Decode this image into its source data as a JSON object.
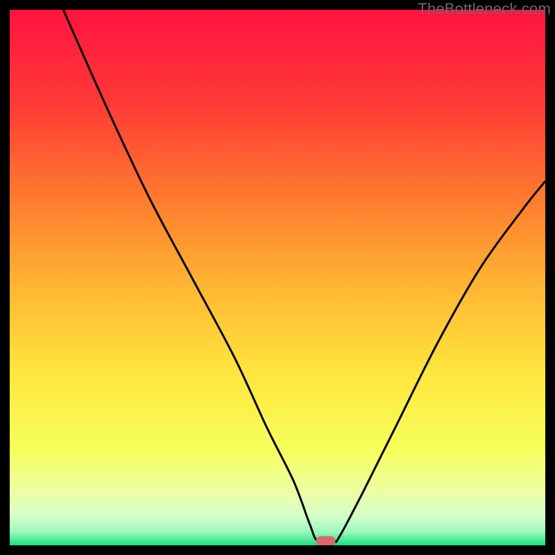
{
  "watermark": "TheBottleneck.com",
  "chart_data": {
    "type": "line",
    "title": "",
    "xlabel": "",
    "ylabel": "",
    "xlim": [
      0,
      100
    ],
    "ylim": [
      0,
      100
    ],
    "curve_points": [
      {
        "x": 10,
        "y": 100
      },
      {
        "x": 18,
        "y": 82
      },
      {
        "x": 26,
        "y": 65
      },
      {
        "x": 34,
        "y": 50
      },
      {
        "x": 42,
        "y": 35
      },
      {
        "x": 48,
        "y": 22
      },
      {
        "x": 53,
        "y": 12
      },
      {
        "x": 56,
        "y": 4
      },
      {
        "x": 57.5,
        "y": 0.8
      },
      {
        "x": 60.5,
        "y": 0.8
      },
      {
        "x": 61.5,
        "y": 1.5
      },
      {
        "x": 66,
        "y": 10
      },
      {
        "x": 72,
        "y": 22
      },
      {
        "x": 80,
        "y": 38
      },
      {
        "x": 88,
        "y": 52
      },
      {
        "x": 96,
        "y": 63
      },
      {
        "x": 100,
        "y": 68
      }
    ],
    "marker": {
      "x": 59,
      "y": 0.8
    },
    "gradient_stops": [
      {
        "offset": 0.0,
        "color": "#ff1440"
      },
      {
        "offset": 0.18,
        "color": "#ff3b36"
      },
      {
        "offset": 0.35,
        "color": "#ff7a2e"
      },
      {
        "offset": 0.52,
        "color": "#ffb733"
      },
      {
        "offset": 0.68,
        "color": "#ffe63e"
      },
      {
        "offset": 0.82,
        "color": "#f6ff5a"
      },
      {
        "offset": 0.9,
        "color": "#ecffa3"
      },
      {
        "offset": 0.945,
        "color": "#d6ffca"
      },
      {
        "offset": 0.975,
        "color": "#9cf7c0"
      },
      {
        "offset": 1.0,
        "color": "#17e07a"
      }
    ],
    "marker_color": "#d86a6f",
    "curve_color": "#000000"
  }
}
